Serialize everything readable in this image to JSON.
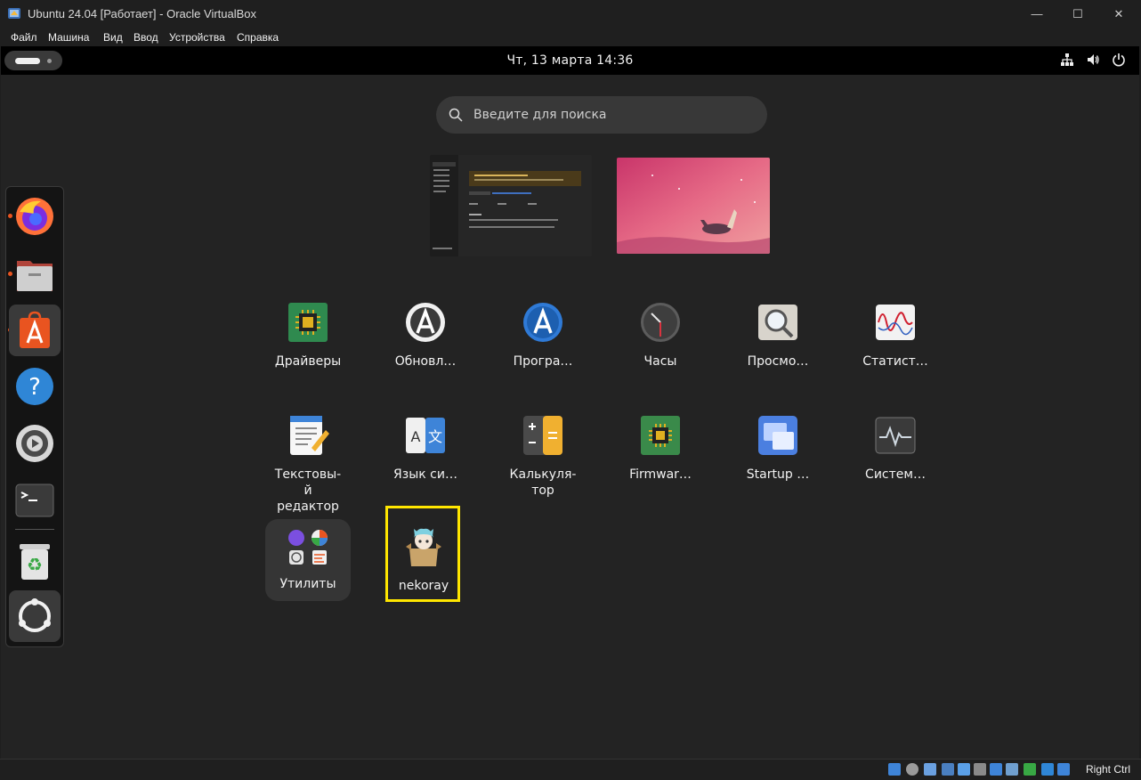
{
  "window": {
    "title": "Ubuntu 24.04 [Работает] - Oracle VirtualBox",
    "minimize_glyph": "—",
    "maximize_glyph": "☐",
    "close_glyph": "✕"
  },
  "menubar": {
    "items": [
      "Файл",
      "Машина",
      "Вид",
      "Ввод",
      "Устройства",
      "Справка"
    ]
  },
  "topbar": {
    "clock": "Чт, 13 марта  14:36",
    "tray_icons": [
      "network-icon",
      "volume-icon",
      "power-icon"
    ]
  },
  "search": {
    "placeholder": "Введите для поиска"
  },
  "dock": {
    "items": [
      {
        "name": "firefox",
        "running": true
      },
      {
        "name": "files",
        "running": true
      },
      {
        "name": "app-center",
        "running": true,
        "active": true
      },
      {
        "name": "help",
        "running": false
      },
      {
        "name": "settings",
        "running": false
      },
      {
        "name": "terminal",
        "running": false
      },
      {
        "name": "trash",
        "running": false
      },
      {
        "name": "show-apps",
        "running": false,
        "active": true
      }
    ]
  },
  "apps": [
    {
      "label": "Драйверы",
      "icon": "chip-icon"
    },
    {
      "label": "Обновл…",
      "icon": "updater-icon"
    },
    {
      "label": "Програ…",
      "icon": "software-icon"
    },
    {
      "label": "Часы",
      "icon": "clock-icon"
    },
    {
      "label": "Просмо…",
      "icon": "magnifier-icon"
    },
    {
      "label": "Статист…",
      "icon": "sysprof-icon"
    },
    {
      "label": "Текстовы-\nй\nредактор",
      "icon": "text-editor-icon"
    },
    {
      "label": "Язык си…",
      "icon": "language-icon"
    },
    {
      "label": "Калькуля-\nтор",
      "icon": "calculator-icon"
    },
    {
      "label": "Firmwar…",
      "icon": "firmware-icon"
    },
    {
      "label": "Startup …",
      "icon": "startup-icon"
    },
    {
      "label": "Систем…",
      "icon": "system-monitor-icon"
    }
  ],
  "folder": {
    "label": "Утилиты"
  },
  "nekoray": {
    "label": "nekoray"
  },
  "statusbar": {
    "host_key": "Right Ctrl"
  },
  "colors": {
    "accent": "#e95420",
    "highlight": "#ffe600",
    "bg": "#232323"
  }
}
